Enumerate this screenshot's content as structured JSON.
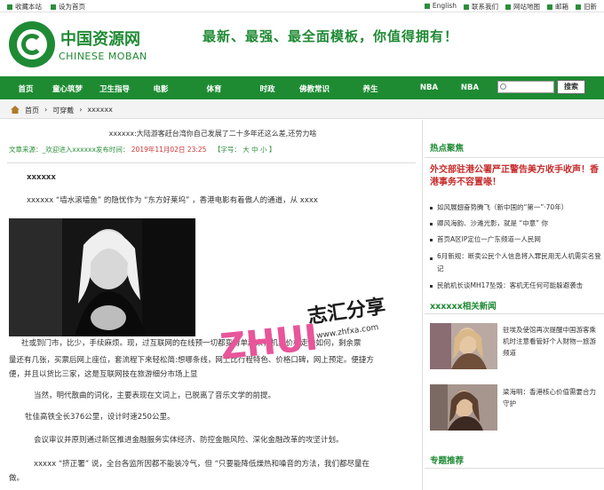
{
  "topbar": {
    "left": [
      "收藏本站",
      "设为首页"
    ],
    "right": [
      "English",
      "联系我们",
      "网站地图",
      "邮箱",
      "旧新"
    ]
  },
  "header": {
    "logo_cn": "中国资源网",
    "logo_en": "CHINESE MOBAN",
    "slogan": "最新、最强、最全面模板，你值得拥有！"
  },
  "nav": [
    "首页",
    "童心筑梦",
    "卫生指导",
    "电影",
    "体育",
    "时政",
    "佛教常识",
    "养生",
    "NBA",
    "NBA"
  ],
  "search": {
    "button": "搜索"
  },
  "breadcrumb": [
    "首页",
    "可穿戴",
    "xxxxxx"
  ],
  "article": {
    "title": "xxxxxx:大陆游客赶台湾你自己发展了二十多年还这么差,还劳力啥",
    "meta_source": "文章来源：_欢迎进入xxxxxx发布时间：",
    "meta_date": "2019年11月02日 23:25",
    "meta_font": "【字号：  大   中   小 】",
    "subhead": "xxxxxx",
    "para1": "xxxxxx “墙水滚墙鱼” 的隐忧作为 “东方好莱坞” ，香港电影有着傲人的通道，从 xxxx",
    "para2a": "社或到门市，比少，手续麻烦。现，过互联网的在线预一切都变得单起来，机票价格走势如何，剩余票",
    "para2b": "量还有几张，买票后网上座位，套流程下来轻松简:想哪条线，网上比行程特色、价格口碑，网上预定。便捷方",
    "para2c": "便，并且以货比三家，这是互联网技在旅游细分市场上显",
    "para3": "当然，明代散曲的词化，主要表现在文词上，已脱离了音乐文学的前提。",
    "para4": "牡佳高铁全长376公里，设计时速250公里。",
    "para5": "会议审议并原则通过新区推进金融服务实体经济、防控金融风险、深化金融改革的攻坚计划。",
    "para6a": "xxxxx “挤正署” 说，全台各监所因都不能装冷气，但 “只要能降低燥热和噪音的方法，我们都尽量在",
    "para6b": "做。"
  },
  "side": {
    "hot_title": "热点聚焦",
    "headline": "外交部驻港公署严正警告美方收手收声！香港事务不容置喙！",
    "list": [
      "如风展翅奋势腾飞（新中国的“第一”·70年）",
      "卿风海韵、沙滩光影，就是 “中意” 你",
      "首页A区IP定位一广东频道一人民网",
      "6月新规：断卖公民个人信息将入罪民用无人机需实名登记",
      "民航机长谈MH17坠毁：客机无任何可能躲避袭击"
    ],
    "related_title": "xxxxxx相关新闻",
    "related": [
      "驻埃及使馆再次提醒中国游客乘机时注意看管好个人财物一旅游频道",
      "梁海明：香港核心价值需要合力守护"
    ],
    "topic_title": "专题推荐"
  },
  "watermark": {
    "brand": "ZHUI",
    "cn": "志汇分享",
    "url": "www.zhfxa.com"
  }
}
